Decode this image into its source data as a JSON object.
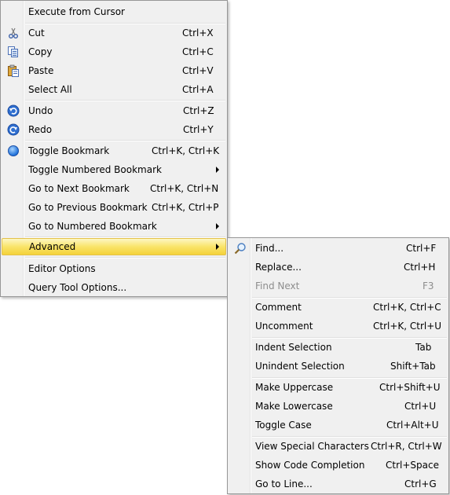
{
  "main_menu": {
    "items": [
      {
        "label": "Execute from Cursor",
        "shortcut": ""
      },
      {
        "label": "Cut",
        "shortcut": "Ctrl+X",
        "icon": "scissors-icon"
      },
      {
        "label": "Copy",
        "shortcut": "Ctrl+C",
        "icon": "copy-icon"
      },
      {
        "label": "Paste",
        "shortcut": "Ctrl+V",
        "icon": "paste-icon"
      },
      {
        "label": "Select All",
        "shortcut": "Ctrl+A"
      },
      {
        "label": "Undo",
        "shortcut": "Ctrl+Z",
        "icon": "undo-icon"
      },
      {
        "label": "Redo",
        "shortcut": "Ctrl+Y",
        "icon": "redo-icon"
      },
      {
        "label": "Toggle Bookmark",
        "shortcut": "Ctrl+K, Ctrl+K",
        "icon": "bookmark-icon"
      },
      {
        "label": "Toggle Numbered Bookmark",
        "shortcut": ""
      },
      {
        "label": "Go to Next Bookmark",
        "shortcut": "Ctrl+K, Ctrl+N"
      },
      {
        "label": "Go to Previous Bookmark",
        "shortcut": "Ctrl+K, Ctrl+P"
      },
      {
        "label": "Go to Numbered Bookmark",
        "shortcut": ""
      },
      {
        "label": "Advanced",
        "shortcut": ""
      },
      {
        "label": "Editor Options",
        "shortcut": ""
      },
      {
        "label": "Query Tool Options...",
        "shortcut": ""
      }
    ]
  },
  "advanced_menu": {
    "items": [
      {
        "label": "Find...",
        "shortcut": "Ctrl+F",
        "icon": "find-icon"
      },
      {
        "label": "Replace...",
        "shortcut": "Ctrl+H"
      },
      {
        "label": "Find Next",
        "shortcut": "F3"
      },
      {
        "label": "Comment",
        "shortcut": "Ctrl+K, Ctrl+C"
      },
      {
        "label": "Uncomment",
        "shortcut": "Ctrl+K, Ctrl+U"
      },
      {
        "label": "Indent Selection",
        "shortcut": "Tab"
      },
      {
        "label": "Unindent Selection",
        "shortcut": "Shift+Tab"
      },
      {
        "label": "Make Uppercase",
        "shortcut": "Ctrl+Shift+U"
      },
      {
        "label": "Make Lowercase",
        "shortcut": "Ctrl+U"
      },
      {
        "label": "Toggle Case",
        "shortcut": "Ctrl+Alt+U"
      },
      {
        "label": "View Special Characters",
        "shortcut": "Ctrl+R, Ctrl+W"
      },
      {
        "label": "Show Code Completion",
        "shortcut": "Ctrl+Space"
      },
      {
        "label": "Go to Line...",
        "shortcut": "Ctrl+G"
      }
    ]
  },
  "colors": {
    "menu_bg": "#f0f0f0",
    "highlight": "#f9e46a",
    "disabled_text": "#8d8d8d"
  }
}
